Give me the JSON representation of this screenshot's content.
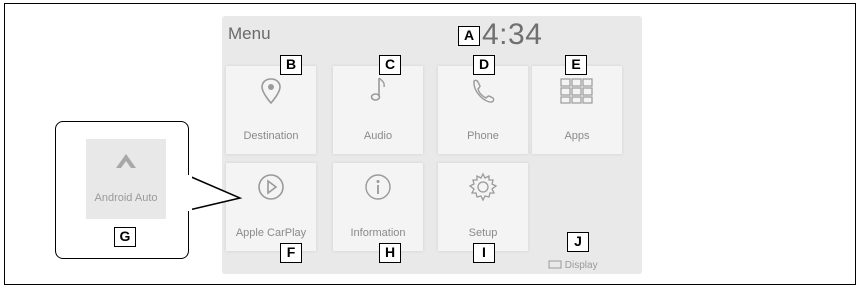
{
  "screen": {
    "menu_title": "Menu",
    "clock": "4:34"
  },
  "tiles": {
    "destination": "Destination",
    "audio": "Audio",
    "phone": "Phone",
    "apps": "Apps",
    "apple_carplay": "Apple CarPlay",
    "information": "Information",
    "setup": "Setup"
  },
  "display_button": "Display",
  "callout": {
    "android_auto": "Android Auto"
  },
  "tags": {
    "A": "A",
    "B": "B",
    "C": "C",
    "D": "D",
    "E": "E",
    "F": "F",
    "G": "G",
    "H": "H",
    "I": "I",
    "J": "J"
  },
  "icons": {
    "destination": "map-pin-icon",
    "audio": "music-note-icon",
    "phone": "phone-icon",
    "apps": "apps-grid-icon",
    "apple_carplay": "play-circle-icon",
    "information": "info-icon",
    "setup": "gear-icon",
    "android_auto": "android-auto-icon",
    "display": "display-icon"
  }
}
